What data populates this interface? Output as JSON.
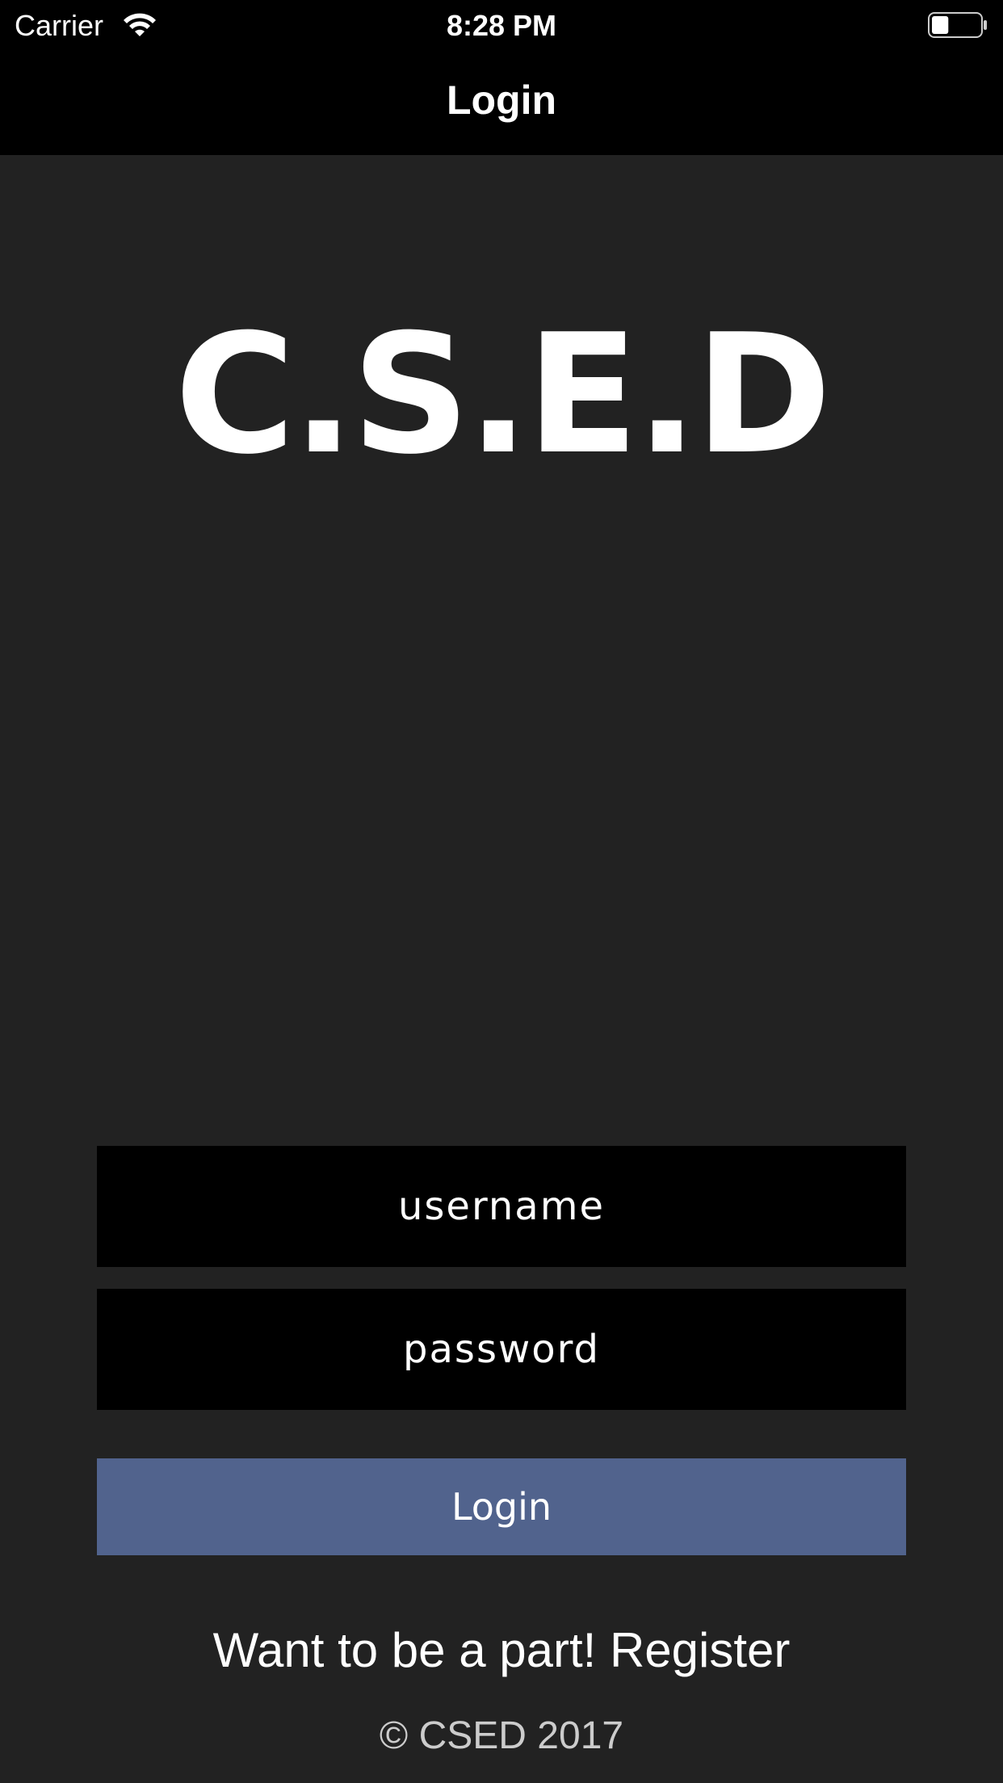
{
  "status_bar": {
    "carrier": "Carrier",
    "time": "8:28 PM",
    "wifi_icon": "wifi-icon",
    "battery_icon": "battery-icon",
    "battery_level": 0.35
  },
  "nav": {
    "title": "Login"
  },
  "logo": {
    "text": "C.S.E.D"
  },
  "form": {
    "username_placeholder": "username",
    "password_placeholder": "password",
    "login_label": "Login"
  },
  "footer": {
    "register_text": "Want to be a part! Register",
    "copyright": "© CSED 2017"
  },
  "colors": {
    "background": "#222222",
    "bar": "#000000",
    "field": "#000000",
    "button": "#51638d",
    "text": "#ffffff"
  }
}
